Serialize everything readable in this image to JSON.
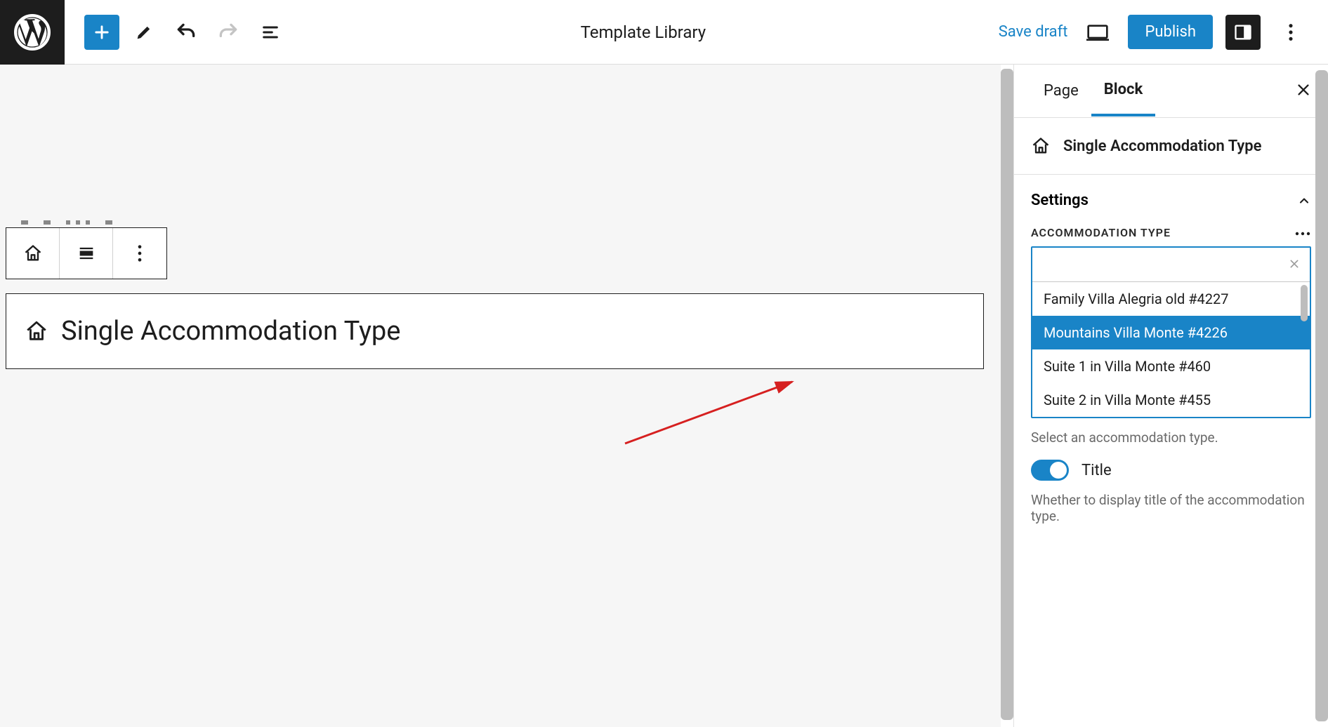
{
  "toolbar": {
    "center_title": "Template Library",
    "save_draft_label": "Save draft",
    "publish_label": "Publish"
  },
  "block": {
    "title": "Single Accommodation Type"
  },
  "sidebar": {
    "tabs": {
      "page": "Page",
      "block": "Block"
    },
    "block_header": "Single Accommodation Type",
    "settings_label": "Settings",
    "field_label": "ACCOMMODATION TYPE",
    "options": [
      "Family Villa Alegria old #4227",
      "Mountains Villa Monte #4226",
      "Suite 1 in Villa Monte #460",
      "Suite 2 in Villa Monte #455"
    ],
    "selected_index": 1,
    "help_select": "Select an accommodation type.",
    "toggle_title_label": "Title",
    "toggle_title_help": "Whether to display title of the accommodation type.",
    "toggle_title_on": true
  },
  "colors": {
    "brand": "#1984c7",
    "text": "#1d1d1d"
  }
}
